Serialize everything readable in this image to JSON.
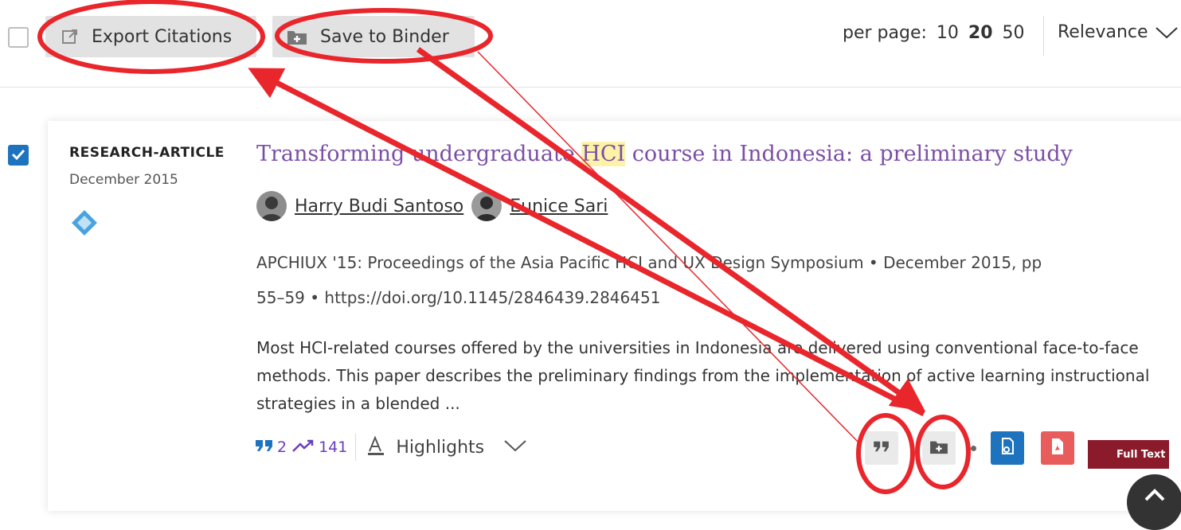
{
  "toolbar": {
    "export_label": "Export Citations",
    "binder_label": "Save to Binder",
    "per_page_label": "per page:",
    "per_page_options": [
      "10",
      "20",
      "50"
    ],
    "per_page_selected": "20",
    "sort_label": "Relevance"
  },
  "result": {
    "type": "RESEARCH-ARTICLE",
    "date": "December 2015",
    "title_before": "Transforming undergraduate ",
    "title_highlight": "HCI",
    "title_after": " course in Indonesia: a preliminary study",
    "authors": [
      "Harry Budi Santoso",
      "Eunice Sari"
    ],
    "meta_line1": "APCHIUX '15: Proceedings of the Asia Pacific HCI and UX Design Symposium • December 2015, pp",
    "meta_line2": "55–59 • https://doi.org/10.1145/2846439.2846451",
    "abstract": "Most HCI-related courses offered by the universities in Indonesia are delivered using conventional face-to-face methods. This paper describes the preliminary findings from the implementation of active learning instructional strategies in a blended ...",
    "citations": "2",
    "downloads": "141",
    "highlights_label": "Highlights",
    "fulltext_label": "Full Text"
  },
  "colors": {
    "accent_blue": "#1e73be",
    "title_purple": "#7b4fa6",
    "annotation_red": "#e8262b",
    "pdf_red": "#e85c5c"
  }
}
